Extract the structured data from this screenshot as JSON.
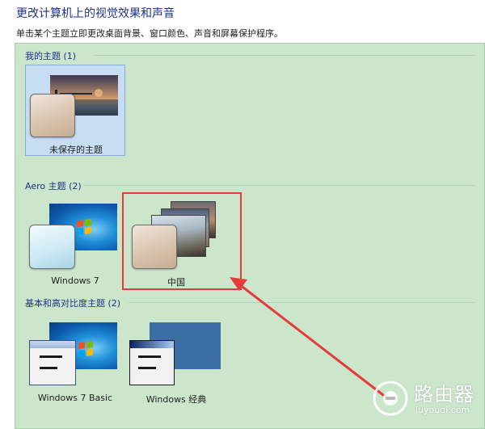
{
  "header": {
    "title": "更改计算机上的视觉效果和声音",
    "subtitle": "单击某个主题立即更改桌面背景、窗口颜色、声音和屏幕保护程序。"
  },
  "groups": {
    "my_themes": {
      "heading": "我的主题 (1)",
      "items": [
        {
          "label": "未保存的主题",
          "selected": true
        }
      ]
    },
    "aero_themes": {
      "heading": "Aero 主题 (2)",
      "items": [
        {
          "label": "Windows 7"
        },
        {
          "label": "中国"
        }
      ]
    },
    "basic_themes": {
      "heading": "基本和高对比度主题 (2)",
      "items": [
        {
          "label": "Windows 7 Basic"
        },
        {
          "label": "Windows 经典"
        }
      ]
    }
  },
  "watermark": {
    "name": "路由器",
    "domain": "luyouqi.com"
  },
  "colors": {
    "panel_background": "#cce6cc",
    "header_text": "#1e3287",
    "highlight": "#e53b3b",
    "selection": "#c7ddf4"
  },
  "icons": [
    "windows-logo-icon",
    "router-logo-icon"
  ]
}
